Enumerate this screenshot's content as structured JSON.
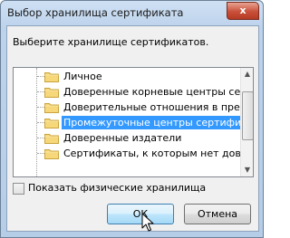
{
  "window": {
    "title": "Выбор хранилища сертификата",
    "close_glyph": "x"
  },
  "prompt": "Выберите хранилище сертификатов.",
  "tree": {
    "items": [
      {
        "label": "Личное",
        "selected": false
      },
      {
        "label": "Доверенные корневые центры сертиф",
        "selected": false
      },
      {
        "label": "Доверительные отношения в предпри",
        "selected": false
      },
      {
        "label": "Промежуточные центры сертификаци",
        "selected": true
      },
      {
        "label": "Доверенные издатели",
        "selected": false
      },
      {
        "label": "Сертификаты, к которым нет довери",
        "selected": false
      }
    ],
    "item_icon": "folder-icon"
  },
  "show_physical": {
    "label": "Показать физические хранилища",
    "checked": false
  },
  "buttons": {
    "ok": "ОК",
    "cancel": "Отмена"
  },
  "colors": {
    "selection": "#3399ff",
    "title_bar": "#bdd3ec",
    "close_button": "#c9503a"
  }
}
